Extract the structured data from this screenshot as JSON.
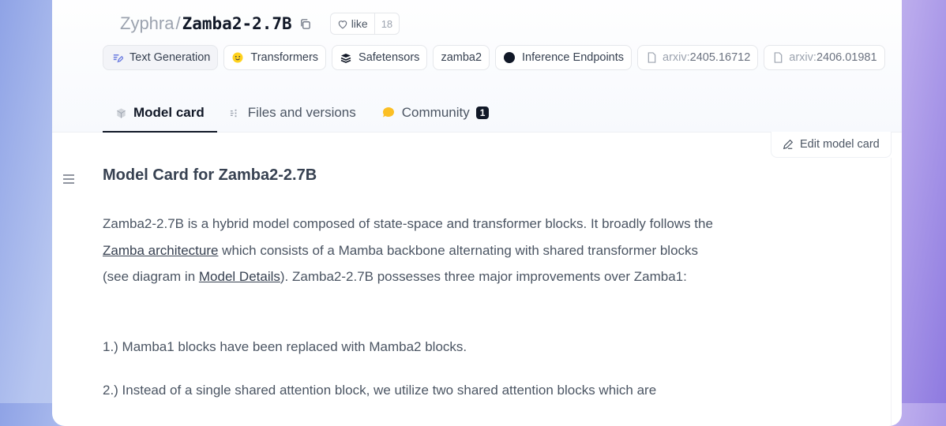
{
  "header": {
    "org": "Zyphra",
    "separator": "/",
    "model": "Zamba2-2.7B",
    "like_label": "like",
    "like_count": "18"
  },
  "tags": [
    {
      "label": "Text Generation",
      "icon": "text-generation-icon"
    },
    {
      "label": "Transformers",
      "icon": "hugging-face-icon"
    },
    {
      "label": "Safetensors",
      "icon": "safetensors-icon"
    },
    {
      "label": "zamba2",
      "icon": ""
    },
    {
      "label": "Inference Endpoints",
      "icon": "inference-endpoints-icon"
    },
    {
      "prefix": "arxiv:",
      "number": "2405.16712",
      "icon": "document-icon"
    },
    {
      "prefix": "arxiv:",
      "number": "2406.01981",
      "icon": "document-icon"
    }
  ],
  "tabs": [
    {
      "label": "Model card",
      "active": true,
      "icon": "cube-icon"
    },
    {
      "label": "Files and versions",
      "active": false,
      "icon": "files-icon"
    },
    {
      "label": "Community",
      "active": false,
      "icon": "community-icon",
      "badge": "1"
    }
  ],
  "edit_label": "Edit model card",
  "content": {
    "title": "Model Card for Zamba2-2.7B",
    "p1_a": "Zamba2-2.7B is a hybrid model composed of state-space and transformer blocks. It broadly follows the ",
    "p1_link1": "Zamba architecture",
    "p1_b": " which consists of a Mamba backbone alternating with shared transformer blocks (see diagram in ",
    "p1_link2": "Model Details",
    "p1_c": "). Zamba2-2.7B possesses three major improvements over Zamba1:",
    "p2": "1.) Mamba1 blocks have been replaced with Mamba2 blocks.",
    "p3": "2.) Instead of a single shared attention block, we utilize two shared attention blocks which are"
  },
  "colors": {
    "accent_dark": "#111827",
    "muted": "#9ca3af",
    "text": "#4b5563"
  }
}
